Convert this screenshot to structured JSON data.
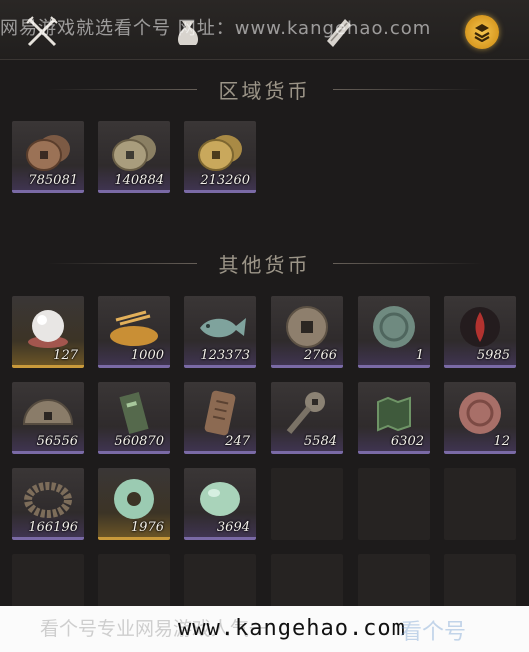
{
  "watermark_top": "网易游戏就选看个号   网址：www.kangehao.com",
  "tabs": [
    {
      "name": "crossed-swords-icon"
    },
    {
      "name": "pouch-icon"
    },
    {
      "name": "scroll-icon"
    },
    {
      "name": "coin-stack-icon",
      "active": true
    }
  ],
  "sections": {
    "regional": {
      "title": "区域货币",
      "items": [
        {
          "icon": "copper-coin-stack-icon",
          "count": "785081"
        },
        {
          "icon": "silver-coin-stack-icon",
          "count": "140884"
        },
        {
          "icon": "gold-coin-stack-icon",
          "count": "213260"
        }
      ]
    },
    "other": {
      "title": "其他货币",
      "items": [
        {
          "icon": "pearl-icon",
          "count": "127",
          "rarity": "gold"
        },
        {
          "icon": "grain-pile-icon",
          "count": "1000"
        },
        {
          "icon": "jade-fish-icon",
          "count": "123373"
        },
        {
          "icon": "bronze-coin-icon",
          "count": "2766"
        },
        {
          "icon": "jade-medallion-icon",
          "count": "1"
        },
        {
          "icon": "red-flame-token-icon",
          "count": "5985"
        },
        {
          "icon": "half-coin-icon",
          "count": "56556"
        },
        {
          "icon": "jade-tablet-icon",
          "count": "560870"
        },
        {
          "icon": "bronze-plaque-icon",
          "count": "247"
        },
        {
          "icon": "spade-coin-icon",
          "count": "5584"
        },
        {
          "icon": "map-fragment-icon",
          "count": "6302"
        },
        {
          "icon": "red-medallion-icon",
          "count": "12"
        },
        {
          "icon": "bead-bracelet-icon",
          "count": "166196"
        },
        {
          "icon": "jade-bi-disc-icon",
          "count": "1976",
          "rarity": "gold"
        },
        {
          "icon": "jade-stone-icon",
          "count": "3694"
        }
      ]
    }
  },
  "bottom_banner": {
    "faint_text": "看个号专业网易游戏人气一",
    "url": "www.kangehao.com",
    "logo_text": "看个号"
  },
  "colors": {
    "background": "#1d1b1b",
    "purple_rarity": "#7a6aa6",
    "gold_rarity": "#c99a3b",
    "active_tab": "#f3c75a"
  }
}
